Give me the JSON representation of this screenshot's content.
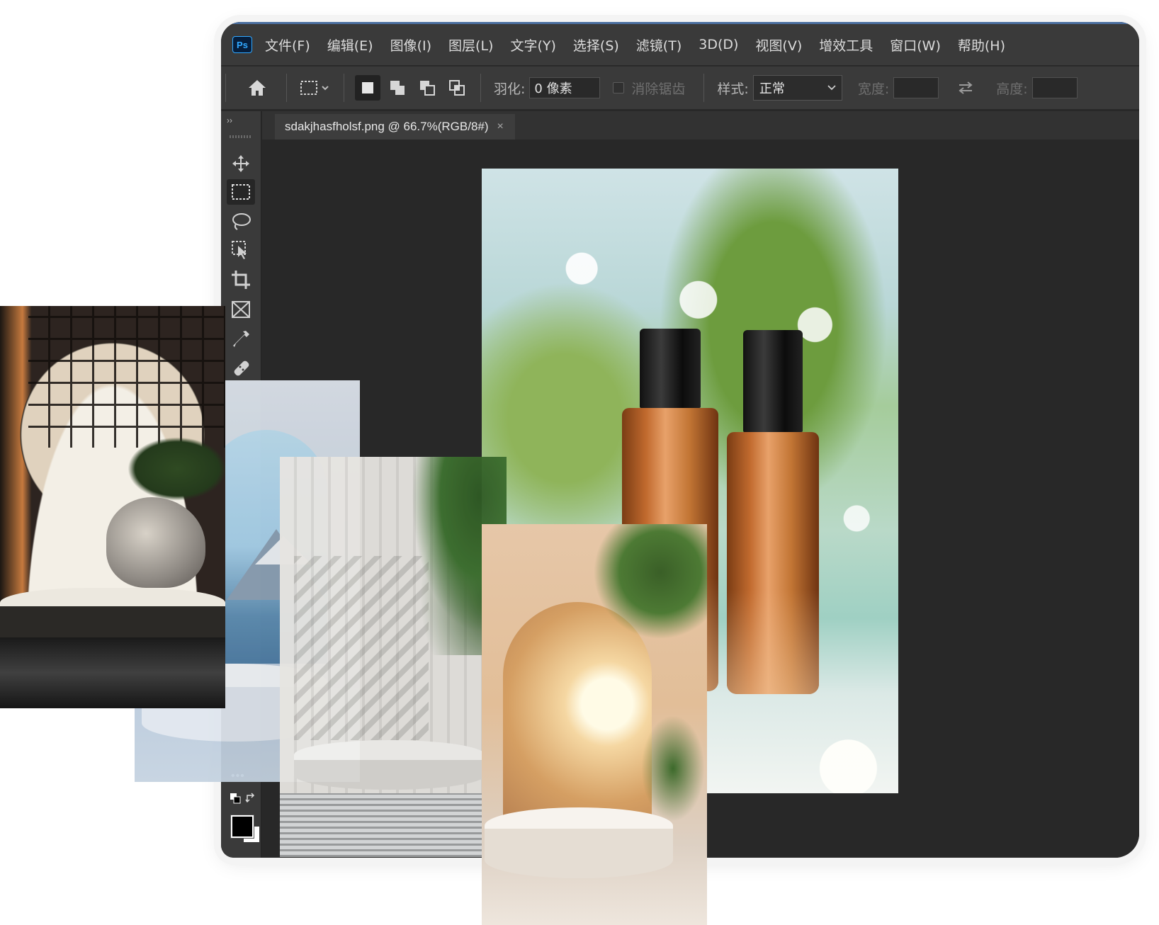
{
  "app": {
    "logo": "Ps",
    "menu": [
      "文件(F)",
      "编辑(E)",
      "图像(I)",
      "图层(L)",
      "文字(Y)",
      "选择(S)",
      "滤镜(T)",
      "3D(D)",
      "视图(V)",
      "增效工具",
      "窗口(W)",
      "帮助(H)"
    ]
  },
  "options": {
    "feather_label": "羽化:",
    "feather_value": "0 像素",
    "antialias_label": "消除锯齿",
    "style_label": "样式:",
    "style_value": "正常",
    "width_label": "宽度:",
    "height_label": "高度:"
  },
  "document": {
    "tab_title": "sdakjhasfholsf.png @ 66.7%(RGB/8#)",
    "close": "×"
  },
  "toolbar": {
    "collapse": "››",
    "tools": [
      "move-icon",
      "marquee-icon",
      "lasso-icon",
      "object-select-icon",
      "crop-icon",
      "frame-icon",
      "eyedropper-icon",
      "healing-icon"
    ],
    "more": "•••"
  },
  "colors": {
    "foreground": "#000000",
    "background": "#ffffff"
  }
}
